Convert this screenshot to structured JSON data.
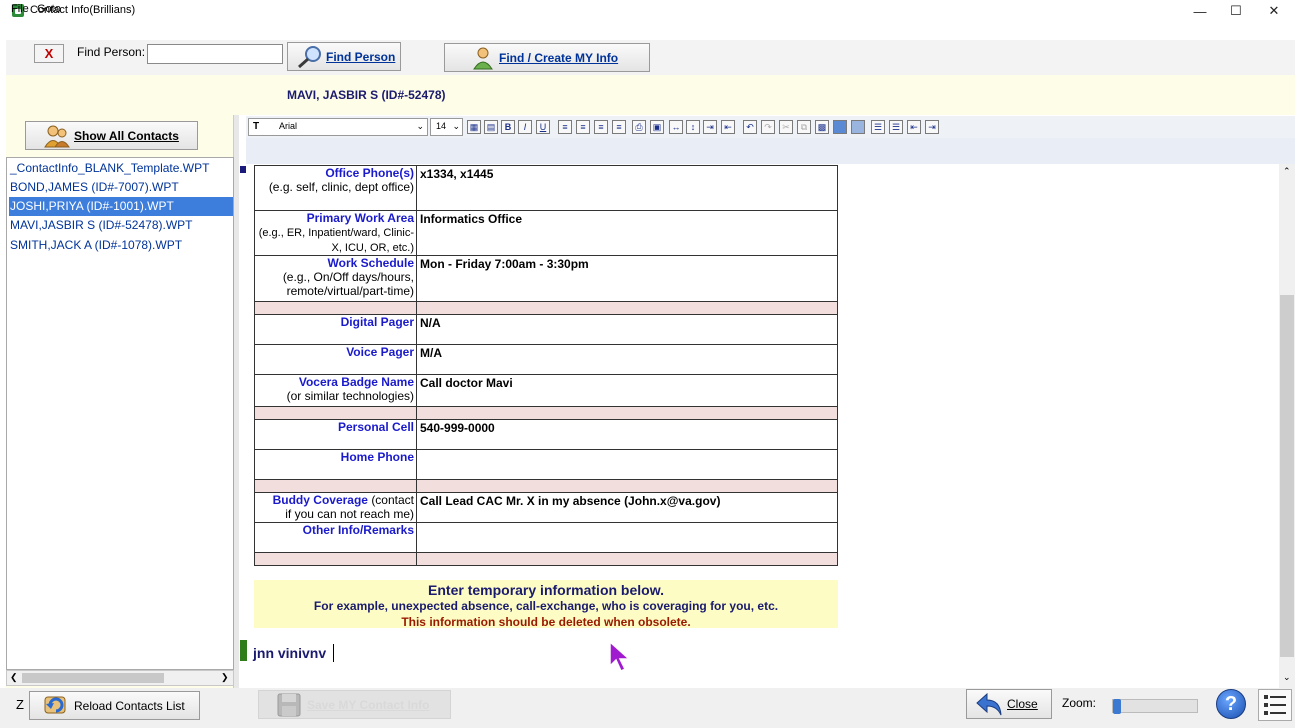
{
  "window": {
    "title": "Contact Info(Brillians)",
    "minimize": "—",
    "maximize": "☐",
    "close": "✕"
  },
  "menu": {
    "items": [
      "File",
      "Goto"
    ]
  },
  "toolbar": {
    "clear_label": "X",
    "find_label": "Find Person:",
    "find_value": "",
    "find_button": "Find Person",
    "find_my_button": "Find / Create MY Info"
  },
  "header": {
    "person_title": "MAVI, JASBIR S (ID#-52478)"
  },
  "sidebar": {
    "show_all": "Show All Contacts",
    "items": [
      {
        "label": "_ContactInfo_BLANK_Template.WPT",
        "selected": false
      },
      {
        "label": "BOND,JAMES (ID#-7007).WPT",
        "selected": false
      },
      {
        "label": "JOSHI,PRIYA (ID#-1001).WPT",
        "selected": true
      },
      {
        "label": "MAVI,JASBIR S (ID#-52478).WPT",
        "selected": false
      },
      {
        "label": "SMITH,JACK A (ID#-1078).WPT",
        "selected": false
      }
    ]
  },
  "format_toolbar": {
    "font": "Arial",
    "size": "14"
  },
  "contact_table": {
    "office_phone": {
      "key": "Office Phone(s)",
      "hint": "(e.g. self, clinic, dept office)",
      "value": "x1334, x1445"
    },
    "primary_work_area": {
      "key": "Primary Work Area",
      "hint": "(e.g., ER, Inpatient/ward, Clinic-X, ICU, OR, etc.)",
      "value": "Informatics Office"
    },
    "work_schedule": {
      "key": "Work Schedule",
      "hint": "(e.g., On/Off days/hours, remote/virtual/part-time)",
      "value": "Mon - Friday 7:00am - 3:30pm"
    },
    "digital_pager": {
      "key": "Digital Pager",
      "value": "N/A"
    },
    "voice_pager": {
      "key": "Voice Pager",
      "value": "M/A"
    },
    "vocera": {
      "key": "Vocera Badge Name",
      "hint": "(or similar technologies)",
      "value": "Call doctor Mavi"
    },
    "personal_cell": {
      "key": "Personal Cell",
      "value": "540-999-0000"
    },
    "home_phone": {
      "key": "Home Phone",
      "value": ""
    },
    "buddy_coverage": {
      "key": "Buddy Coverage",
      "hint_a": "(contact",
      "hint_b": "if you can not reach me)",
      "value": "Call Lead CAC Mr. X in my absence (John.x@va.gov)"
    },
    "other_info": {
      "key": "Other Info/Remarks",
      "value": ""
    }
  },
  "notice": {
    "line1": "Enter temporary information below.",
    "line2": "For example, unexpected absence, call-exchange, who is coveraging for you, etc.",
    "line3": "This information should be deleted when obsolete."
  },
  "temp_text": "jnn vinivnv",
  "bottom": {
    "z_label": "Z",
    "reload": "Reload Contacts List",
    "save": "Save MY Contact Info",
    "close": "Close",
    "zoom_label": "Zoom:",
    "zoom_level": 0.05,
    "help": "?"
  }
}
